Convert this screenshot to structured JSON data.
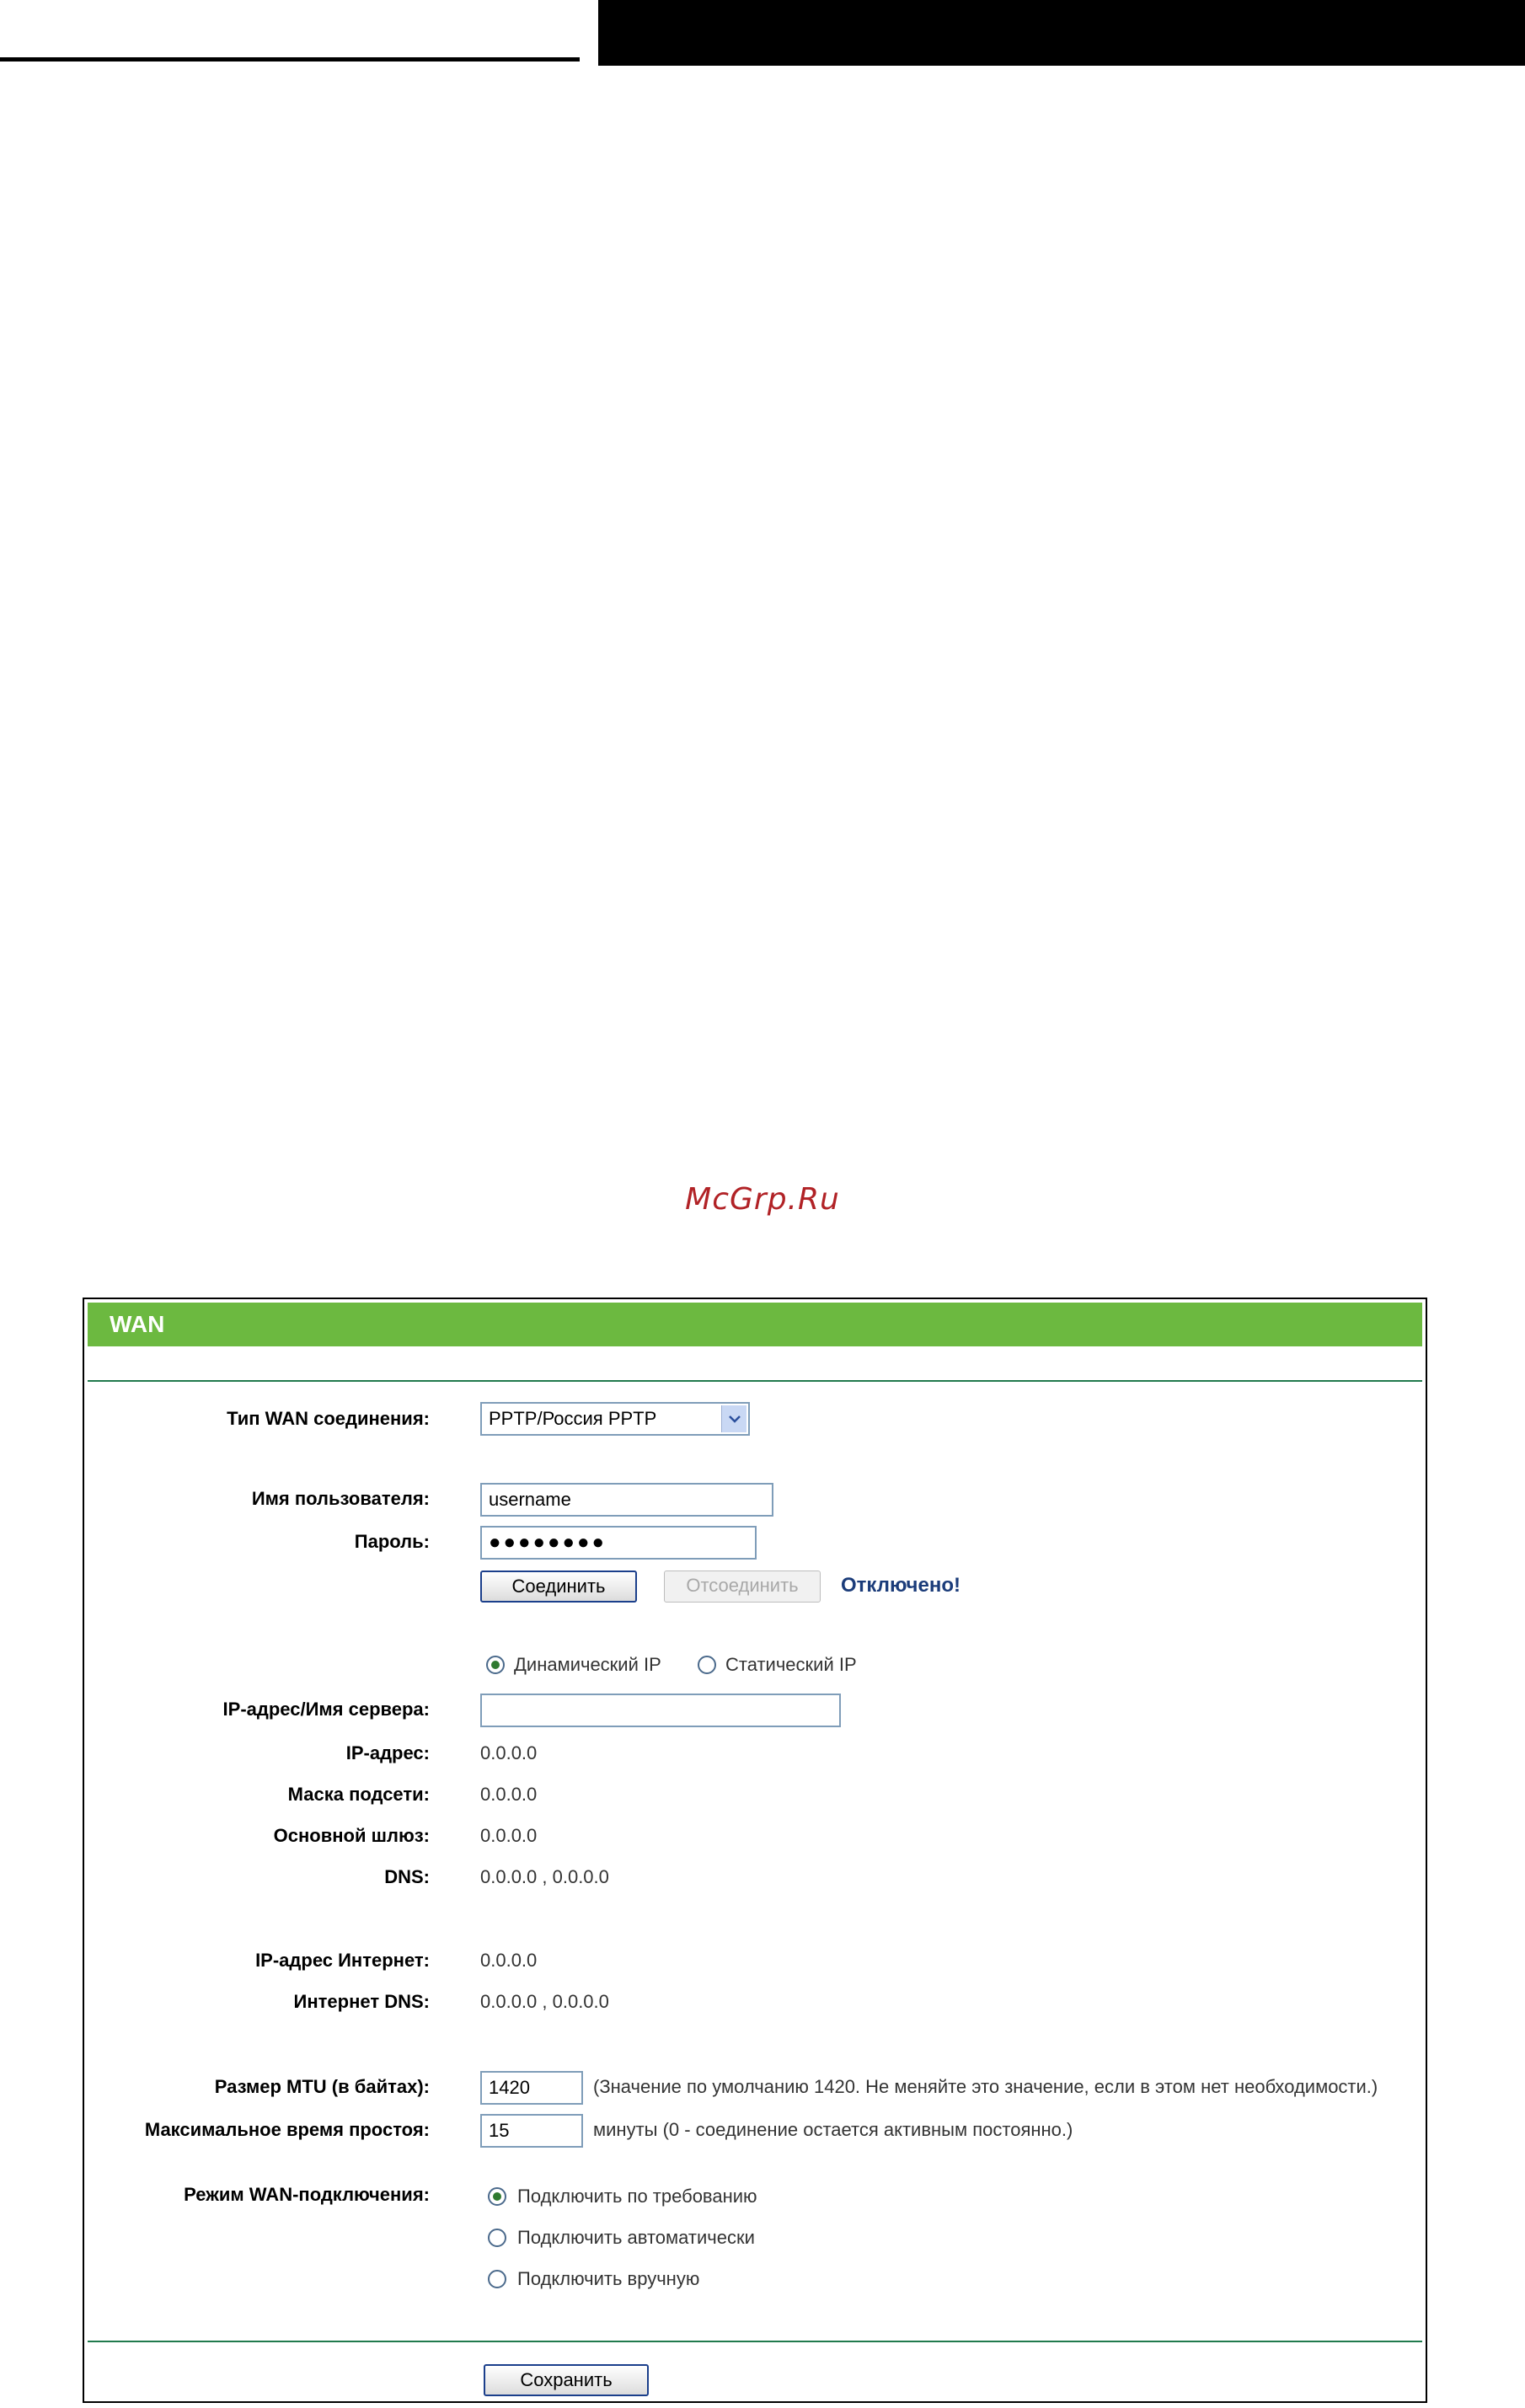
{
  "watermark": "McGrp.Ru",
  "panel": {
    "title": "WAN",
    "wan_type": {
      "label": "Тип WAN соединения:",
      "value": "PPTP/Россия PPTP"
    },
    "username": {
      "label": "Имя пользователя:",
      "value": "username"
    },
    "password": {
      "label": "Пароль:",
      "value": "●●●●●●●●"
    },
    "connect_label": "Соединить",
    "disconnect_label": "Отсоединить",
    "status": "Отключено!",
    "ip_mode": {
      "dynamic": "Динамический IP",
      "static": "Статический IP",
      "selected": "dynamic"
    },
    "server": {
      "label": "IP-адрес/Имя сервера:",
      "value": ""
    },
    "ip": {
      "label": "IP-адрес:",
      "value": "0.0.0.0"
    },
    "mask": {
      "label": "Маска подсети:",
      "value": "0.0.0.0"
    },
    "gateway": {
      "label": "Основной шлюз:",
      "value": "0.0.0.0"
    },
    "dns": {
      "label": "DNS:",
      "value": "0.0.0.0 , 0.0.0.0"
    },
    "internet_ip": {
      "label": "IP-адрес Интернет:",
      "value": "0.0.0.0"
    },
    "internet_dns": {
      "label": "Интернет DNS:",
      "value": "0.0.0.0 , 0.0.0.0"
    },
    "mtu": {
      "label": "Размер MTU (в байтах):",
      "value": "1420",
      "hint": "(Значение по умолчанию 1420. Не меняйте это значение, если в этом нет необходимости.)"
    },
    "idle": {
      "label": "Максимальное время простоя:",
      "value": "15",
      "hint": "минуты (0 - соединение остается активным постоянно.)"
    },
    "wan_mode": {
      "label": "Режим WAN-подключения:",
      "options": [
        "Подключить по требованию",
        "Подключить автоматически",
        "Подключить вручную"
      ],
      "selected": 0
    },
    "save_label": "Сохранить"
  }
}
